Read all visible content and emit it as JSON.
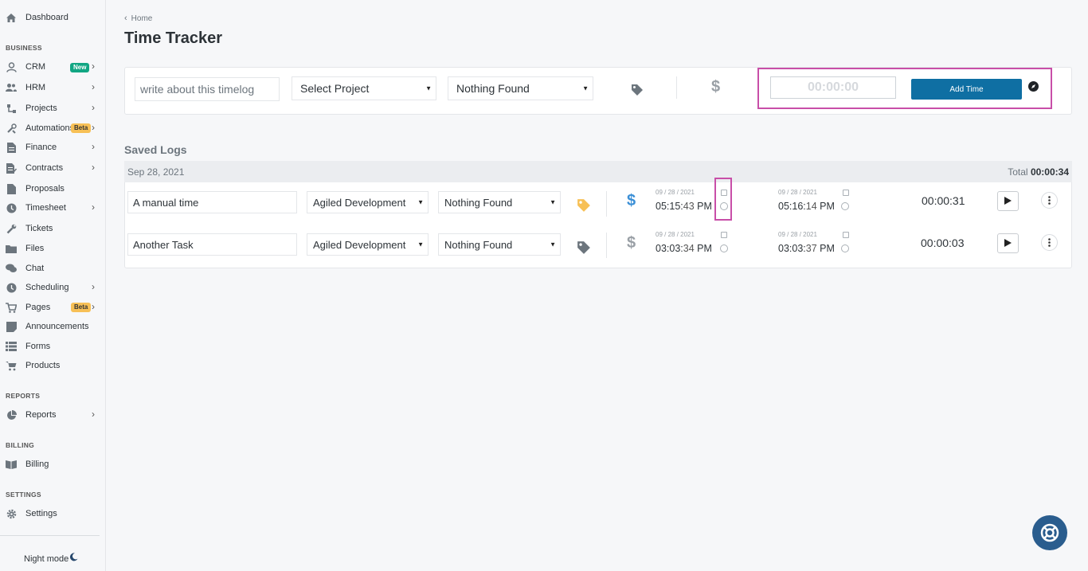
{
  "sidebar": {
    "dashboard": "Dashboard",
    "sections": {
      "business": "BUSINESS",
      "reports": "REPORTS",
      "billing": "BILLING",
      "settings": "SETTINGS"
    },
    "items": [
      {
        "label": "CRM",
        "badge": "New"
      },
      {
        "label": "HRM"
      },
      {
        "label": "Projects"
      },
      {
        "label": "Automations",
        "badge": "Beta"
      },
      {
        "label": "Finance"
      },
      {
        "label": "Contracts"
      },
      {
        "label": "Proposals"
      },
      {
        "label": "Timesheet"
      },
      {
        "label": "Tickets"
      },
      {
        "label": "Files"
      },
      {
        "label": "Chat"
      },
      {
        "label": "Scheduling"
      },
      {
        "label": "Pages",
        "badge": "Beta"
      },
      {
        "label": "Announcements"
      },
      {
        "label": "Forms"
      },
      {
        "label": "Products"
      }
    ],
    "reports": "Reports",
    "billing": "Billing",
    "settings": "Settings",
    "night_mode": "Night mode"
  },
  "breadcrumb": {
    "home": "Home"
  },
  "page_title": "Time Tracker",
  "new_log": {
    "description_placeholder": "write about this timelog",
    "project": "Select Project",
    "task": "Nothing Found",
    "timer": "00:00:00",
    "add_button": "Add Time"
  },
  "saved_logs": {
    "title": "Saved Logs",
    "date": "Sep 28, 2021",
    "total_label": "Total",
    "total": "00:00:34",
    "rows": [
      {
        "title": "A manual time",
        "project": "Agiled Development",
        "task": "Nothing Found",
        "start_date": "09 / 28 / 2021",
        "start_hm": "05:15:",
        "start_s": "43",
        "start_ampm": "PM",
        "end_date": "09 / 28 / 2021",
        "end_hm": "05:16:",
        "end_s": "14",
        "end_ampm": "PM",
        "duration": "00:00:31",
        "tag_color": "#f7c056",
        "dollar_color": "#3b8fd6"
      },
      {
        "title": "Another Task",
        "project": "Agiled Development",
        "task": "Nothing Found",
        "start_date": "09 / 28 / 2021",
        "start_hm": "03:03:",
        "start_s": "34",
        "start_ampm": "PM",
        "end_date": "09 / 28 / 2021",
        "end_hm": "03:03:",
        "end_s": "37",
        "end_ampm": "PM",
        "duration": "00:00:03",
        "tag_color": "#6c757d",
        "dollar_color": "#9aa0a6"
      }
    ]
  },
  "colors": {
    "accent": "#0f6fa3",
    "highlight": "#c84ea8",
    "new_badge": "#11a683",
    "beta_badge": "#f7c056"
  }
}
